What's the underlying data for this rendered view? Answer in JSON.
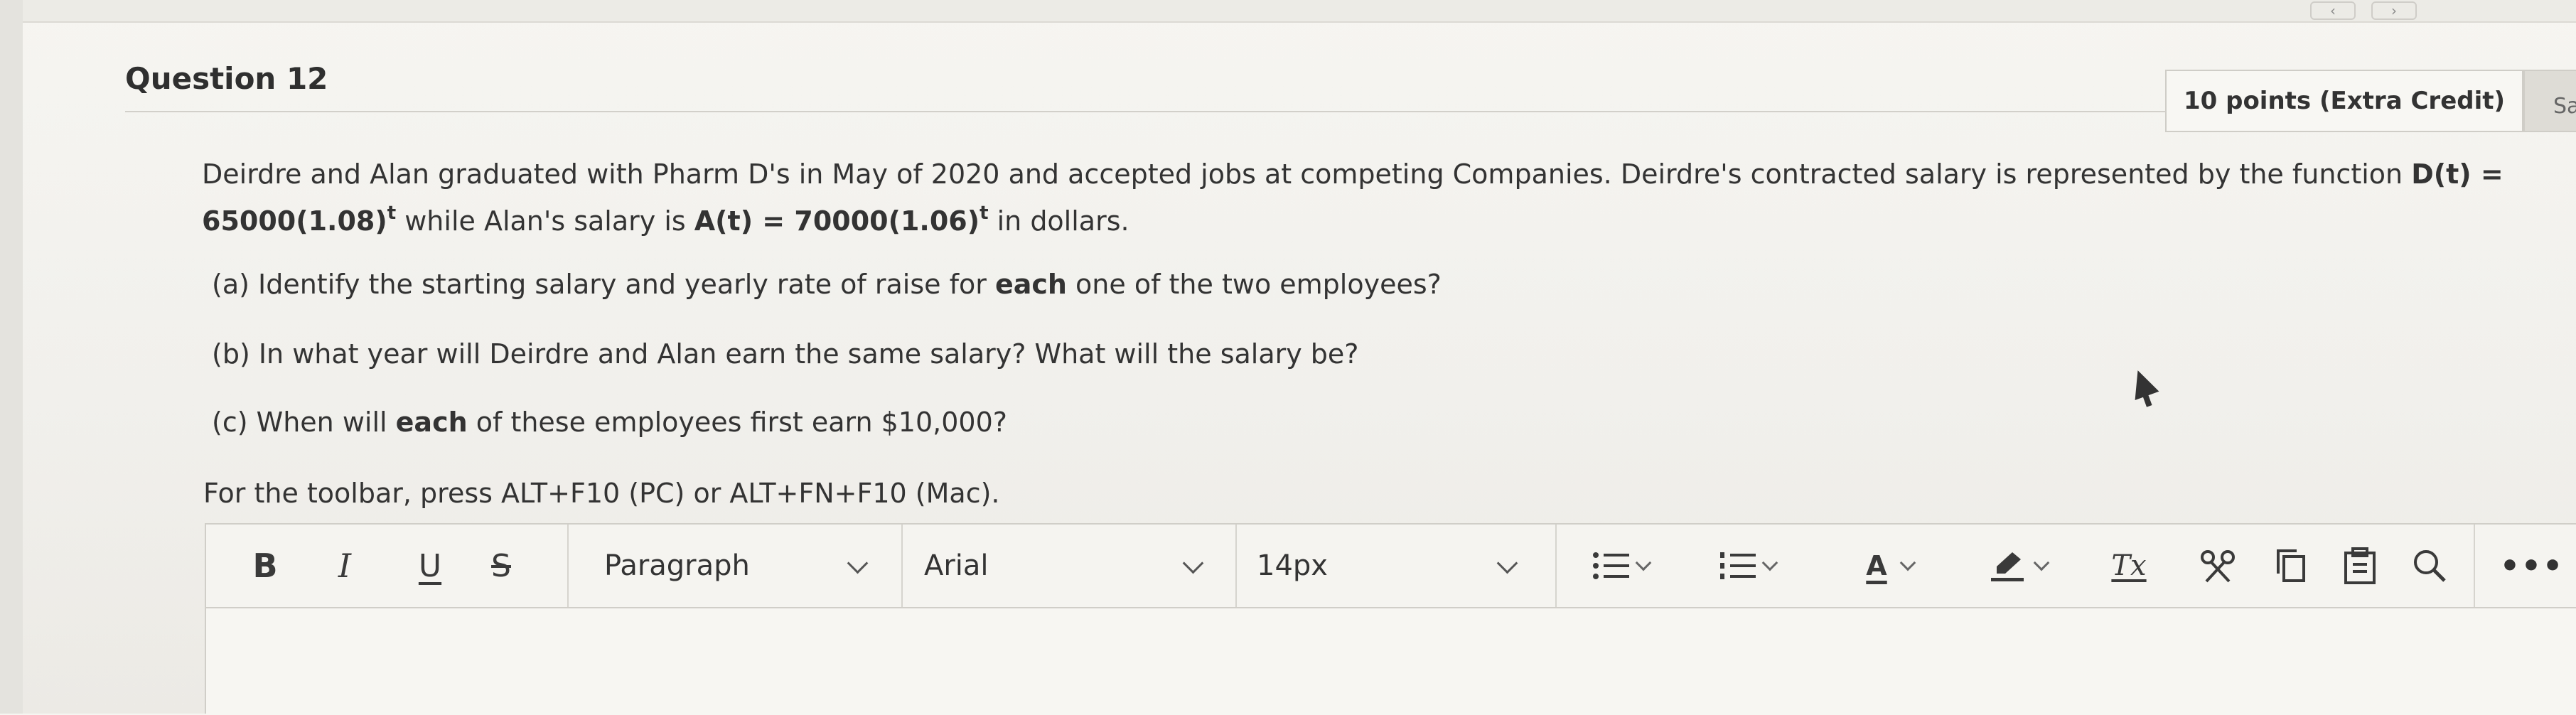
{
  "header": {
    "question_title": "Question 12",
    "points_label": "10 points (Extra Credit)",
    "save_label": "Sa"
  },
  "question": {
    "line1_text": "Deirdre and Alan graduated with Pharm D's in May of 2020 and accepted jobs at competing Companies. Deirdre's contracted salary is represented by the function ",
    "line1_func": "D(t) =",
    "line2_func_d": "65000(1.08)",
    "exponent": "t",
    "line2_mid": " while Alan's salary is ",
    "line2_func_a": "A(t) = 70000(1.06)",
    "line2_end": " in dollars."
  },
  "parts": {
    "a_pre": "(a) Identify the starting salary and yearly rate of raise for ",
    "a_bold": "each",
    "a_post": " one of the two employees?",
    "b_text": "(b) In what year will Deirdre and Alan earn the same salary? What will the salary be?",
    "c_pre": "(c) When will ",
    "c_bold": "each",
    "c_post": " of these employees first earn $10,000?"
  },
  "keyboard_hint": "For the toolbar, press ALT+F10 (PC) or ALT+FN+F10 (Mac).",
  "toolbar": {
    "bold": "B",
    "italic": "I",
    "underline": "U",
    "strikethrough": "S",
    "paragraph_select": "Paragraph",
    "font_select": "Arial",
    "size_select": "14px",
    "font_color_letter": "A",
    "clear_format": "Tx",
    "more": "•••"
  },
  "icons": [
    "bullet-list-icon",
    "numbered-list-icon",
    "font-color-icon",
    "highlight-icon",
    "clear-formatting-icon",
    "cut-icon",
    "copy-icon",
    "paste-icon",
    "search-icon",
    "more-icon"
  ],
  "colors": {
    "accent_text": "#333333",
    "border": "#d0cec8"
  }
}
